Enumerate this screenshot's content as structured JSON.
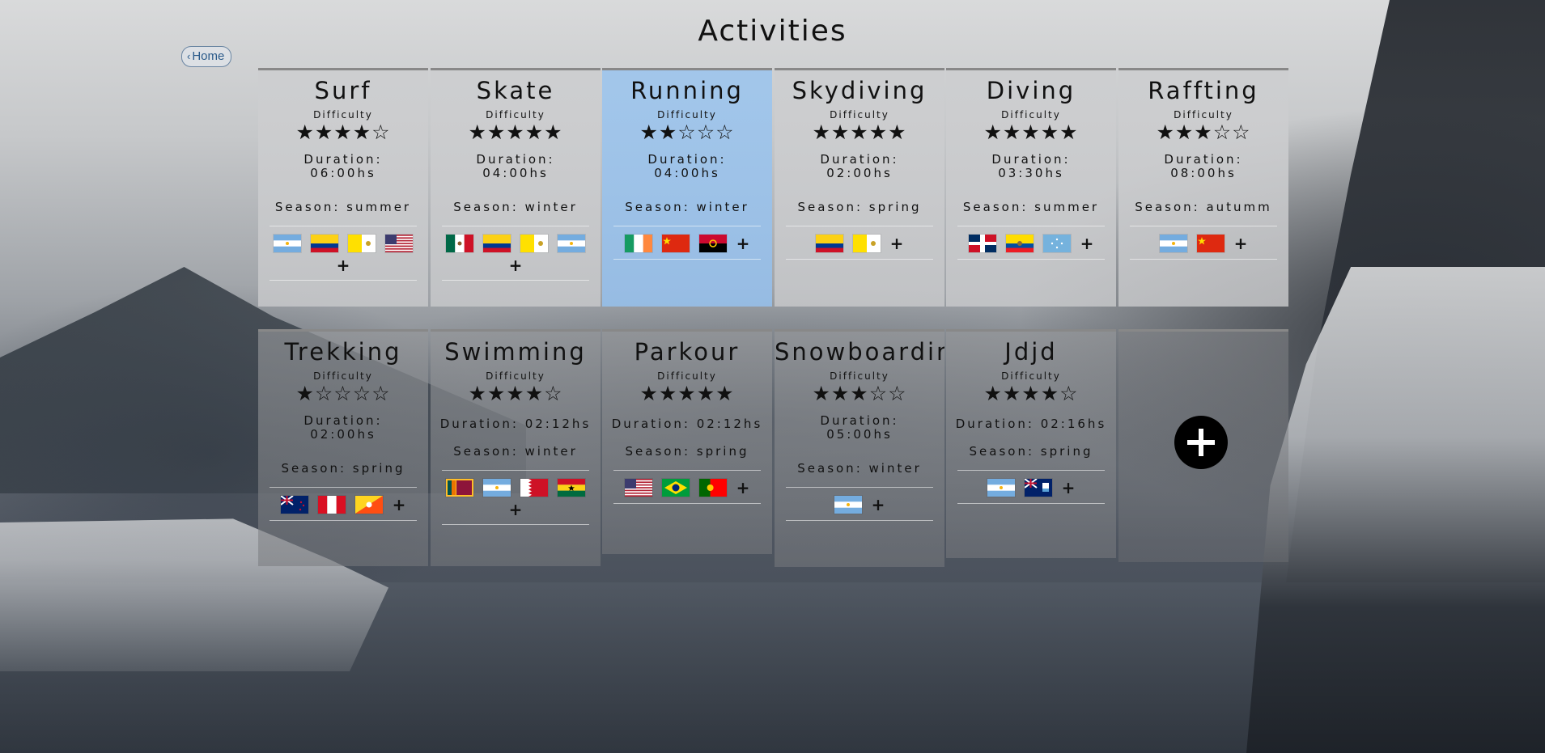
{
  "page": {
    "title": "Activities",
    "home_label": "Home"
  },
  "activities": [
    {
      "name": "Surf",
      "difficulty_label": "Difficulty",
      "stars": "★★★★☆",
      "duration_label": "Duration:",
      "duration": "06:00hs",
      "season": "Season: summer",
      "flags": [
        "Argentina",
        "Colombia",
        "Vatican",
        "United States"
      ]
    },
    {
      "name": "Skate",
      "difficulty_label": "Difficulty",
      "stars": "★★★★★",
      "duration_label": "Duration:",
      "duration": "04:00hs",
      "season": "Season: winter",
      "flags": [
        "Mexico",
        "Colombia",
        "Vatican",
        "Argentina"
      ]
    },
    {
      "name": "Running",
      "difficulty_label": "Difficulty",
      "stars": "★★☆☆☆",
      "duration_label": "Duration:",
      "duration": "04:00hs",
      "season": "Season: winter",
      "flags": [
        "Ireland",
        "China",
        "Angola"
      ]
    },
    {
      "name": "Skydiving",
      "difficulty_label": "Difficulty",
      "stars": "★★★★★",
      "duration_label": "Duration:",
      "duration": "02:00hs",
      "season": "Season: spring",
      "flags": [
        "Colombia",
        "Vatican"
      ]
    },
    {
      "name": "Diving",
      "difficulty_label": "Difficulty",
      "stars": "★★★★★",
      "duration_label": "Duration:",
      "duration": "03:30hs",
      "season": "Season: summer",
      "flags": [
        "Dominican Republic",
        "Ecuador",
        "Micronesia"
      ]
    },
    {
      "name": "Raffting",
      "difficulty_label": "Difficulty",
      "stars": "★★★☆☆",
      "duration_label": "Duration:",
      "duration": "08:00hs",
      "season": "Season: autumm",
      "flags": [
        "Argentina",
        "China"
      ]
    },
    {
      "name": "Trekking",
      "difficulty_label": "Difficulty",
      "stars": "★☆☆☆☆",
      "duration_label": "Duration:",
      "duration": "02:00hs",
      "season": "Season: spring",
      "flags": [
        "New Zealand",
        "Peru",
        "Bhutan"
      ]
    },
    {
      "name": "Swimming",
      "difficulty_label": "Difficulty",
      "stars": "★★★★☆",
      "duration_label": "",
      "duration": "Duration: 02:12hs",
      "season": "Season: winter",
      "flags": [
        "Sri Lanka",
        "Argentina",
        "Bahrain",
        "Ghana"
      ]
    },
    {
      "name": "Parkour",
      "difficulty_label": "Difficulty",
      "stars": "★★★★★",
      "duration_label": "",
      "duration": "Duration: 02:12hs",
      "season": "Season: spring",
      "flags": [
        "United States",
        "Brazil",
        "Portugal"
      ]
    },
    {
      "name": "Snowboarding",
      "difficulty_label": "Difficulty",
      "stars": "★★★☆☆",
      "duration_label": "Duration:",
      "duration": "05:00hs",
      "season": "Season: winter",
      "flags": [
        "Argentina"
      ]
    },
    {
      "name": "Jdjd",
      "difficulty_label": "Difficulty",
      "stars": "★★★★☆",
      "duration_label": "",
      "duration": "Duration: 02:16hs",
      "season": "Season: spring",
      "flags": [
        "Argentina",
        "Anguilla"
      ]
    }
  ],
  "add_flag_label": "+",
  "colors": {
    "highlight": "#9fc5ec",
    "card": "#cdcecf",
    "home_text": "#2b5a8a"
  }
}
